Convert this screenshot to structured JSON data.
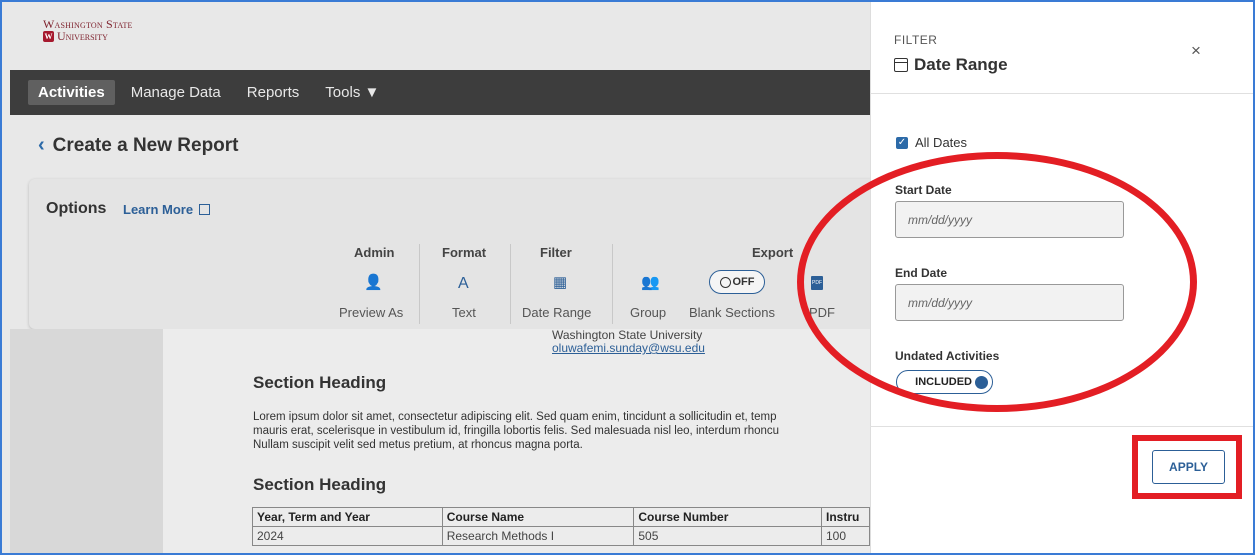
{
  "logo": {
    "line1": "Washington State",
    "line2": "University"
  },
  "nav": {
    "items": [
      "Activities",
      "Manage Data",
      "Reports",
      "Tools ▼"
    ]
  },
  "header": {
    "back_title": "Create a New Report"
  },
  "options": {
    "title": "Options",
    "learn_more": "Learn More",
    "groups": {
      "admin": "Admin",
      "format": "Format",
      "filter": "Filter",
      "export": "Export"
    },
    "tools": {
      "preview_as": "Preview As",
      "text": "Text",
      "date_range": "Date Range",
      "group": "Group",
      "blank_sections": "Blank Sections",
      "toggle_off": "OFF",
      "pdf": "PDF"
    }
  },
  "document": {
    "institution": "Washington State University",
    "email": "oluwafemi.sunday@wsu.edu",
    "heading1": "Section Heading",
    "lorem_lines": [
      "Lorem ipsum dolor sit amet, consectetur adipiscing elit. Sed quam enim, tincidunt a sollicitudin et, temp",
      "mauris erat, scelerisque in vestibulum id, fringilla lobortis felis. Sed malesuada nisl leo, interdum rhoncu",
      "Nullam suscipit velit sed metus pretium, at rhoncus magna porta."
    ],
    "heading2": "Section Heading",
    "table": {
      "headers": [
        "Year, Term and Year",
        "Course Name",
        "Course Number",
        "Instru"
      ],
      "rows": [
        [
          "2024",
          "Research Methods I",
          "505",
          "100"
        ]
      ]
    }
  },
  "panel": {
    "filter_label": "FILTER",
    "title": "Date Range",
    "close": "×",
    "all_dates": "All Dates",
    "start_label": "Start Date",
    "start_placeholder": "mm/dd/yyyy",
    "end_label": "End Date",
    "end_placeholder": "mm/dd/yyyy",
    "undated_label": "Undated Activities",
    "undated_toggle": "INCLUDED",
    "apply": "APPLY"
  },
  "colors": {
    "accent": "#2c5f97",
    "annotation": "#e31e24",
    "nav_bg": "#3d3d3d"
  }
}
